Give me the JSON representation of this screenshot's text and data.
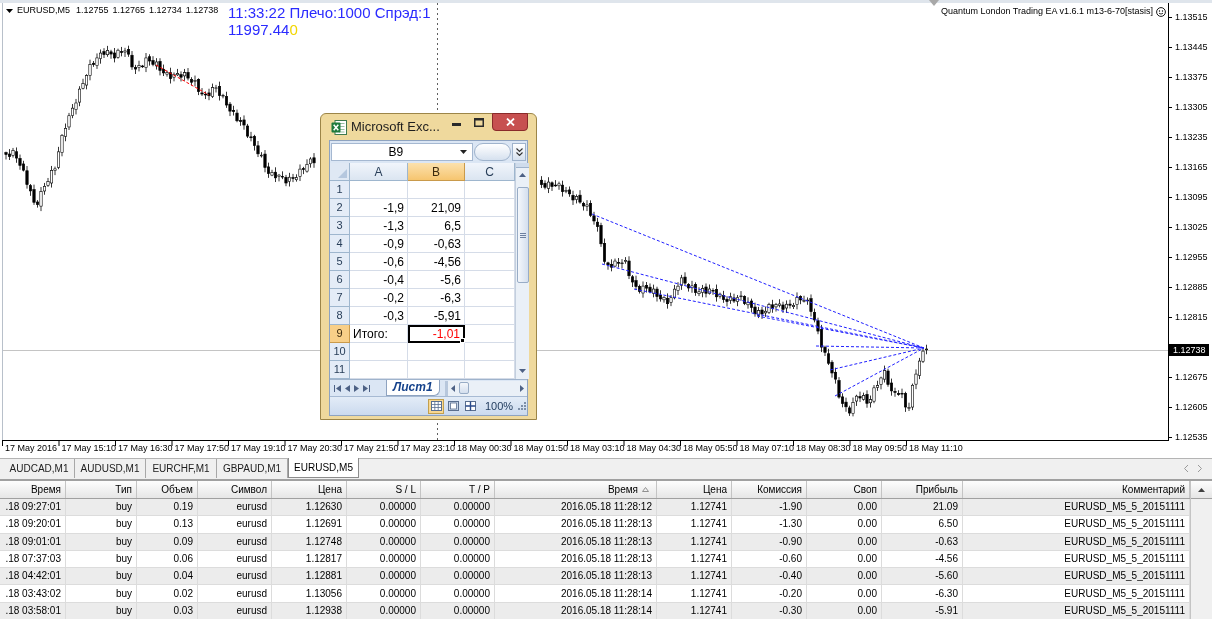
{
  "chart": {
    "symbol": "EURUSD,M5",
    "ohlc": [
      "1.12755",
      "1.12765",
      "1.12734",
      "1.12738"
    ],
    "info": "11:33:22 Плечо:1000 Спрэд:1",
    "balance": "11997.44",
    "balance_extra": "0",
    "expert": "Quantum London Trading EA v1.6.1 m13-6-70[stasis]",
    "price_axis": [
      "1.13515",
      "1.13445",
      "1.13375",
      "1.13305",
      "1.13235",
      "1.13165",
      "1.13095",
      "1.13025",
      "1.12955",
      "1.12885",
      "1.12815",
      "1.12675",
      "1.12605",
      "1.12535"
    ],
    "current_price": "1.12738",
    "time_axis": [
      "17 May 2016",
      "17 May 15:10",
      "17 May 16:30",
      "17 May 17:50",
      "17 May 19:10",
      "17 May 20:30",
      "17 May 21:50",
      "17 May 23:10",
      "18 May 00:30",
      "18 May 01:50",
      "18 May 03:10",
      "18 May 04:30",
      "18 May 05:50",
      "18 May 07:10",
      "18 May 08:30",
      "18 May 09:50",
      "18 May 11:10"
    ]
  },
  "excel": {
    "title": "Microsoft Exc...",
    "name_box": "B9",
    "columns": [
      {
        "label": "A",
        "selected": false
      },
      {
        "label": "B",
        "selected": true
      },
      {
        "label": "C",
        "selected": false
      }
    ],
    "rows": [
      {
        "number": "1",
        "selected": false
      },
      {
        "number": "2",
        "selected": false,
        "cells": [
          {
            "value": "-1,9",
            "kind": "number",
            "color": "#000000",
            "selected": false
          },
          {
            "value": "21,09",
            "kind": "number",
            "color": "#000000",
            "selected": false
          }
        ]
      },
      {
        "number": "3",
        "selected": false,
        "cells": [
          {
            "value": "-1,3",
            "kind": "number",
            "color": "#000000",
            "selected": false
          },
          {
            "value": "6,5",
            "kind": "number",
            "color": "#000000",
            "selected": false
          }
        ]
      },
      {
        "number": "4",
        "selected": false,
        "cells": [
          {
            "value": "-0,9",
            "kind": "number",
            "color": "#000000",
            "selected": false
          },
          {
            "value": "-0,63",
            "kind": "number",
            "color": "#000000",
            "selected": false
          }
        ]
      },
      {
        "number": "5",
        "selected": false,
        "cells": [
          {
            "value": "-0,6",
            "kind": "number",
            "color": "#000000",
            "selected": false
          },
          {
            "value": "-4,56",
            "kind": "number",
            "color": "#000000",
            "selected": false
          }
        ]
      },
      {
        "number": "6",
        "selected": false,
        "cells": [
          {
            "value": "-0,4",
            "kind": "number",
            "color": "#000000",
            "selected": false
          },
          {
            "value": "-5,6",
            "kind": "number",
            "color": "#000000",
            "selected": false
          }
        ]
      },
      {
        "number": "7",
        "selected": false,
        "cells": [
          {
            "value": "-0,2",
            "kind": "number",
            "color": "#000000",
            "selected": false
          },
          {
            "value": "-6,3",
            "kind": "number",
            "color": "#000000",
            "selected": false
          }
        ]
      },
      {
        "number": "8",
        "selected": false,
        "cells": [
          {
            "value": "-0,3",
            "kind": "number",
            "color": "#000000",
            "selected": false
          },
          {
            "value": "-5,91",
            "kind": "number",
            "color": "#000000",
            "selected": false
          }
        ]
      },
      {
        "number": "9",
        "selected": true,
        "cells": [
          {
            "value": "Итого:",
            "kind": "text",
            "color": "#000000",
            "selected": false
          },
          {
            "value": "-1,01",
            "kind": "number",
            "color": "#ff0000",
            "selected": true
          }
        ]
      },
      {
        "number": "10",
        "selected": false
      },
      {
        "number": "11",
        "selected": false
      }
    ],
    "sheets": [
      {
        "label": "Лист1",
        "selected": true
      }
    ],
    "views": [
      {
        "kind": "normal",
        "selected": true
      },
      {
        "kind": "page_layout",
        "selected": false
      },
      {
        "kind": "page_break",
        "selected": false
      }
    ],
    "zoom": "100%"
  },
  "tabs": [
    {
      "label": "AUDCAD,M1",
      "selected": false
    },
    {
      "label": "AUDUSD,M1",
      "selected": false
    },
    {
      "label": "EURCHF,M1",
      "selected": false
    },
    {
      "label": "GBPAUD,M1",
      "selected": false
    },
    {
      "label": "EURUSD,M5",
      "selected": true
    }
  ],
  "table": {
    "columns": [
      {
        "label": "Время",
        "sorted": false
      },
      {
        "label": "Тип",
        "sorted": false
      },
      {
        "label": "Объем",
        "sorted": false
      },
      {
        "label": "Символ",
        "sorted": false
      },
      {
        "label": "Цена",
        "sorted": false
      },
      {
        "label": "S / L",
        "sorted": false
      },
      {
        "label": "T / P",
        "sorted": false
      },
      {
        "label": "Время",
        "sorted": true
      },
      {
        "label": "Цена",
        "sorted": false
      },
      {
        "label": "Комиссия",
        "sorted": false
      },
      {
        "label": "Своп",
        "sorted": false
      },
      {
        "label": "Прибыль",
        "sorted": false
      },
      {
        "label": "Комментарий",
        "sorted": false
      }
    ],
    "rows": [
      [
        ".18 09:27:01",
        "buy",
        "0.19",
        "eurusd",
        "1.12630",
        "0.00000",
        "0.00000",
        "2016.05.18 11:28:12",
        "1.12741",
        "-1.90",
        "0.00",
        "21.09",
        "EURUSD_M5_5_20151111"
      ],
      [
        ".18 09:20:01",
        "buy",
        "0.13",
        "eurusd",
        "1.12691",
        "0.00000",
        "0.00000",
        "2016.05.18 11:28:13",
        "1.12741",
        "-1.30",
        "0.00",
        "6.50",
        "EURUSD_M5_5_20151111"
      ],
      [
        ".18 09:01:01",
        "buy",
        "0.09",
        "eurusd",
        "1.12748",
        "0.00000",
        "0.00000",
        "2016.05.18 11:28:13",
        "1.12741",
        "-0.90",
        "0.00",
        "-0.63",
        "EURUSD_M5_5_20151111"
      ],
      [
        ".18 07:37:03",
        "buy",
        "0.06",
        "eurusd",
        "1.12817",
        "0.00000",
        "0.00000",
        "2016.05.18 11:28:13",
        "1.12741",
        "-0.60",
        "0.00",
        "-4.56",
        "EURUSD_M5_5_20151111"
      ],
      [
        ".18 04:42:01",
        "buy",
        "0.04",
        "eurusd",
        "1.12881",
        "0.00000",
        "0.00000",
        "2016.05.18 11:28:13",
        "1.12741",
        "-0.40",
        "0.00",
        "-5.60",
        "EURUSD_M5_5_20151111"
      ],
      [
        ".18 03:43:02",
        "buy",
        "0.02",
        "eurusd",
        "1.13056",
        "0.00000",
        "0.00000",
        "2016.05.18 11:28:14",
        "1.12741",
        "-0.20",
        "0.00",
        "-6.30",
        "EURUSD_M5_5_20151111"
      ],
      [
        ".18 03:58:01",
        "buy",
        "0.03",
        "eurusd",
        "1.12938",
        "0.00000",
        "0.00000",
        "2016.05.18 11:28:14",
        "1.12741",
        "-0.30",
        "0.00",
        "-5.91",
        "EURUSD_M5_5_20151111"
      ]
    ]
  }
}
